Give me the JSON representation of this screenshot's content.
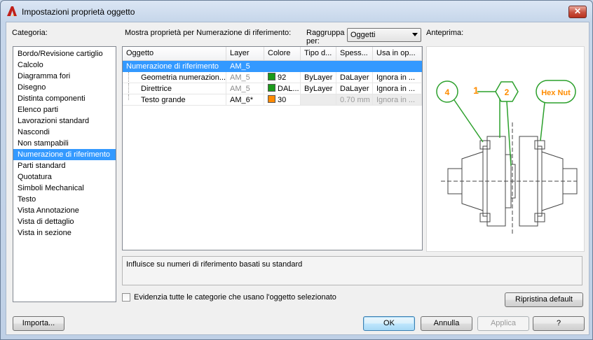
{
  "window": {
    "title": "Impostazioni proprietà oggetto",
    "close_label": "✕"
  },
  "category": {
    "label": "Categoria:",
    "items": [
      "Bordo/Revisione cartiglio",
      "Calcolo",
      "Diagramma fori",
      "Disegno",
      "Distinta componenti",
      "Elenco parti",
      "Lavorazioni standard",
      "Nascondi",
      "Non stampabili",
      "Numerazione di riferimento",
      "Parti standard",
      "Quotatura",
      "Simboli Mechanical",
      "Testo",
      "Vista Annotazione",
      "Vista di dettaglio",
      "Vista in sezione"
    ],
    "selected": "Numerazione di riferimento"
  },
  "properties": {
    "label": "Mostra proprietà per Numerazione di riferimento:",
    "group_label_1": "Raggruppa",
    "group_label_2": "per:",
    "group_value": "Oggetti",
    "columns": [
      "Oggetto",
      "Layer",
      "Colore",
      "Tipo d...",
      "Spess...",
      "Usa in op..."
    ],
    "rows": [
      {
        "oggetto": "Numerazione di riferimento",
        "layer": "AM_5",
        "colore": "",
        "tipo": "",
        "spess": "",
        "usa": ""
      },
      {
        "oggetto": "Geometria numerazion...",
        "layer": "AM_5",
        "colore": "92",
        "colore_hex": "#1a9a1a",
        "tipo": "ByLayer",
        "spess": "DaLayer",
        "usa": "Ignora in ..."
      },
      {
        "oggetto": "Direttrice",
        "layer": "AM_5",
        "colore": "DAL...",
        "colore_hex": "#1a9a1a",
        "tipo": "ByLayer",
        "spess": "DaLayer",
        "usa": "Ignora in ..."
      },
      {
        "oggetto": "Testo grande",
        "layer": "AM_6*",
        "colore": "30",
        "colore_hex": "#ff8a00",
        "tipo": "",
        "spess": "0.70 mm",
        "usa": "Ignora in ..."
      }
    ]
  },
  "preview": {
    "label": "Anteprima:",
    "balloons": [
      "4",
      "1",
      "2",
      "Hex Nut"
    ],
    "colors": {
      "balloon": "#2ca02c",
      "text": "#ff8c00",
      "drawing": "#444444"
    }
  },
  "description": "Influisce su numeri di riferimento basati su standard",
  "highlight_checkbox": {
    "label": "Evidenzia tutte le categorie che usano l'oggetto selezionato",
    "checked": false
  },
  "buttons": {
    "reset": "Ripristina default",
    "import": "Importa...",
    "ok": "OK",
    "cancel": "Annulla",
    "apply": "Applica",
    "help": "?"
  }
}
